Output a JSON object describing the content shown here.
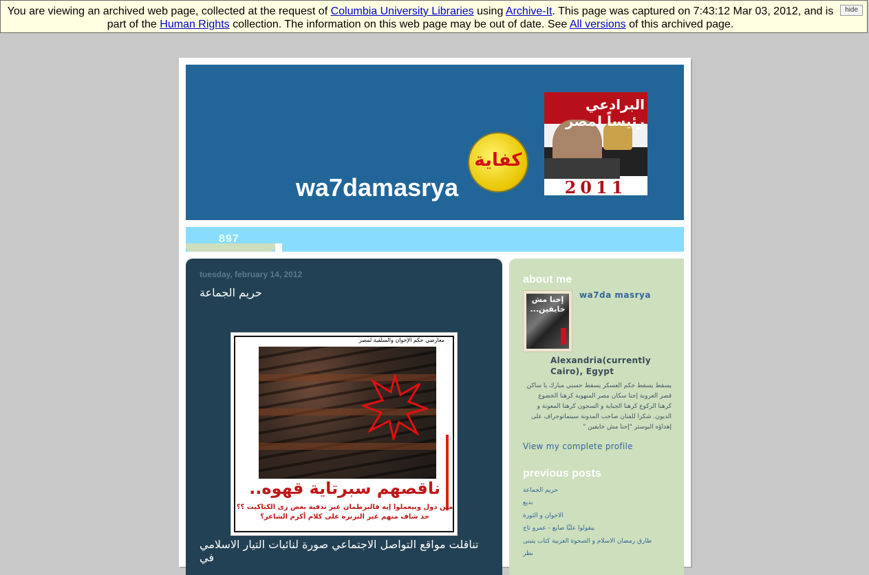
{
  "archive_banner": {
    "text_1": "You are viewing an archived web page, collected at the request of ",
    "link_1": "Columbia University Libraries",
    "text_2": " using ",
    "link_2": "Archive-It",
    "text_3": ". This page was captured on 7:43:12 Mar 03, 2012, and is part of the ",
    "link_3": "Human Rights",
    "text_4": " collection. The information on this web page may be out of date. See ",
    "link_4": "All versions",
    "text_5": " of this archived page.",
    "hide_label": "hide"
  },
  "header": {
    "blog_title": "wa7damasrya",
    "kefaya_text": "كفاية",
    "poster_headline": "البرادعي رئيساً لمصر",
    "poster_year": "2011"
  },
  "nav": {
    "counter": "897"
  },
  "post": {
    "date": "tuesday, february 14, 2012",
    "title": "حريم الجماعة",
    "image_caption_top": "معارضي حكم الإخوان والسلفية لمصر",
    "image_text_big": "ناقصهم سبرتاية قهوه..",
    "image_text_small_1": "مين دول وبيعملوا إيه فالبرطمان غير تدفية بعض زى الكتاكيت ؟؟",
    "image_text_small_2": "حد شاف منهم غير البربره على كلام أكرم الشاعر؟",
    "body_first_line": "تناقلت مواقع التواصل الاجتماعي صورة لنائبات التيار الاسلامي في"
  },
  "sidebar": {
    "about_title": "about me",
    "profile_photo_text": "إحنا مش خايفين...",
    "profile_name": "wa7da masrya",
    "profile_location": "Alexandria(currently Cairo), Egypt",
    "profile_description": "يسقط يسقط حكم العسكر يسقط حسني مبارك يا ساكن قصر العروبة إحنا سكان مصر المنهوبة كرهنا الخضوع كرهنا الركوع كرهنا الجباية و السجون كرهنا المعونة و الديون. شكرا للفنان صاحب المدونة سينماتوجراف على إهداؤه البوستر \"إحنا مش خايفين \"",
    "profile_link": "View my complete profile",
    "previous_title": "previous posts",
    "previous_posts": [
      "حريم الجماعة",
      "بديع",
      "الاخوان و الثورة",
      "بيقولوا عليَّا صايع - عمرو تاج",
      "طارق رمضان الاسلام و الصحوة العربية كتاب يتبنى",
      "نظر"
    ]
  },
  "colors": {
    "header_bg": "#226699",
    "nav_bg": "#88ddff",
    "main_bg": "#234154",
    "sidebar_bg": "#cddfbd",
    "link": "#336699"
  }
}
